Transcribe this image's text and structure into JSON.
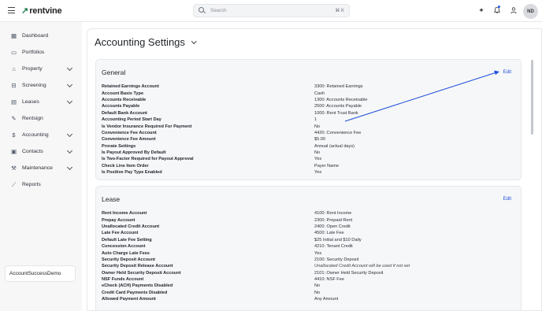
{
  "header": {
    "logo_text": "rentvine",
    "search_placeholder": "Search",
    "search_shortcut": "⌘ K",
    "avatar_initials": "ND"
  },
  "sidebar": {
    "items": [
      {
        "label": "Dashboard",
        "icon": "grid-icon",
        "has_chevron": false
      },
      {
        "label": "Portfolios",
        "icon": "folder-icon",
        "has_chevron": false
      },
      {
        "label": "Property",
        "icon": "building-icon",
        "has_chevron": true
      },
      {
        "label": "Screening",
        "icon": "screening-icon",
        "has_chevron": true
      },
      {
        "label": "Leases",
        "icon": "document-icon",
        "has_chevron": true
      },
      {
        "label": "Rentsign",
        "icon": "pen-icon",
        "has_chevron": false
      },
      {
        "label": "Accounting",
        "icon": "dollar-icon",
        "has_chevron": true
      },
      {
        "label": "Contacts",
        "icon": "contacts-icon",
        "has_chevron": true
      },
      {
        "label": "Maintenance",
        "icon": "wrench-icon",
        "has_chevron": true
      },
      {
        "label": "Reports",
        "icon": "chart-icon",
        "has_chevron": false
      }
    ],
    "account_name": "AccountSuccessDemo"
  },
  "page": {
    "title": "Accounting Settings"
  },
  "general": {
    "title": "General",
    "edit_label": "Edit",
    "rows": [
      {
        "key": "Retained Earnings Account",
        "value": "3300: Retained Earnings"
      },
      {
        "key": "Account Basis Type",
        "value": "Cash"
      },
      {
        "key": "Accounts Receivable",
        "value": "1300: Accounts Receivable"
      },
      {
        "key": "Accounts Payable",
        "value": "2500: Accounts Payable"
      },
      {
        "key": "Default Bank Account",
        "value": "1000: Rent Trust Bank"
      },
      {
        "key": "Accounting Period Start Day",
        "value": "1"
      },
      {
        "key": "Is Vendor Insurance Required For Payment",
        "value": "No"
      },
      {
        "key": "Convenience Fee Account",
        "value": "4420: Convenience Fee"
      },
      {
        "key": "Convenience Fee Amount",
        "value": "$5.00"
      },
      {
        "key": "Prorate Settings",
        "value": "Annual (actual days)"
      },
      {
        "key": "Is Payout Approved By Default",
        "value": "No"
      },
      {
        "key": "Is Two-Factor Required for Payout Approval",
        "value": "Yes"
      },
      {
        "key": "Check Line Item Order",
        "value": "Payer Name"
      },
      {
        "key": "Is Positive Pay Type Enabled",
        "value": "Yes"
      }
    ]
  },
  "lease": {
    "title": "Lease",
    "edit_label": "Edit",
    "rows": [
      {
        "key": "Rent Income Account",
        "value": "4100: Rent Income"
      },
      {
        "key": "Prepay Account",
        "value": "2300: Prepaid Rent"
      },
      {
        "key": "Unallocated Credit Account",
        "value": "2400: Open Credit"
      },
      {
        "key": "Late Fee Account",
        "value": "4500: Late Fee"
      },
      {
        "key": "Default Late Fee Setting",
        "value": "$25 Initial and $10 Daily"
      },
      {
        "key": "Concession Account",
        "value": "4210: Tenant Credit"
      },
      {
        "key": "Auto Charge Late Fees",
        "value": "Yes"
      },
      {
        "key": "Security Deposit Account",
        "value": "2100: Security Deposit"
      },
      {
        "key": "Security Deposit Release Account",
        "value": "Unallocated Credit Account will be used if not set",
        "italic": true
      },
      {
        "key": "Owner Held Security Deposit Account",
        "value": "2101: Owner Held Security Deposit"
      },
      {
        "key": "NSF Funds Account",
        "value": "4410: NSF Fee"
      },
      {
        "key": "eCheck (ACH) Payments Disabled",
        "value": "No"
      },
      {
        "key": "Credit Card Payments Disabled",
        "value": "No"
      },
      {
        "key": "Allowed Payment Amount",
        "value": "Any Amount"
      }
    ]
  },
  "colors": {
    "accent": "#1d4ed8",
    "brand": "#1d7a4e",
    "annotation_arrow": "#1d4ed8"
  }
}
